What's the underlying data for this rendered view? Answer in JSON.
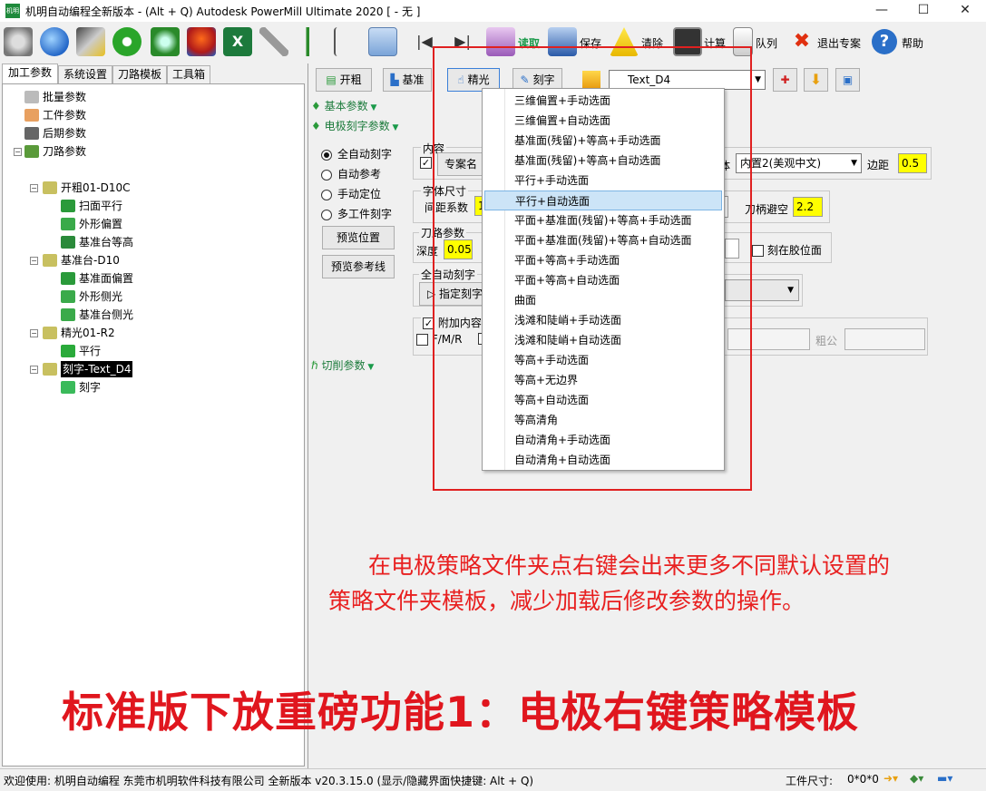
{
  "window": {
    "title": "机明自动编程全新版本 - (Alt + Q) Autodesk PowerMill Ultimate 2020   [ - 无 ]",
    "minimize": "—",
    "maximize": "☐",
    "close": "✕"
  },
  "toolbar": {
    "read": "读取",
    "save": "保存",
    "clear": "清除",
    "calculate": "计算",
    "queue": "队列",
    "exit_project": "退出专案",
    "help": "帮助"
  },
  "left_tabs": [
    "加工参数",
    "系统设置",
    "刀路模板",
    "工具箱"
  ],
  "tree": {
    "batch": "批量参数",
    "workpiece": "工件参数",
    "post": "后期参数",
    "toolpath": "刀路参数",
    "group1": "开粗01-D10C",
    "g1_items": [
      "扫面平行",
      "外形偏置",
      "基准台等高"
    ],
    "group2": "基准台-D10",
    "g2_items": [
      "基准面偏置",
      "外形侧光",
      "基准台侧光"
    ],
    "group3": "精光01-R2",
    "g3_items": [
      "平行"
    ],
    "group4": "刻字-Text_D4",
    "g4_items": [
      "刻字"
    ]
  },
  "strategy_tabs": {
    "rough": "开粗",
    "base": "基准",
    "finish": "精光",
    "engrave": "刻字",
    "text_combo": "Text_D4"
  },
  "sections": {
    "basic": "基本参数",
    "electrode_engrave": "电极刻字参数",
    "cutting": "切削参数"
  },
  "engrave_mode": {
    "options": [
      "全自动刻字",
      "自动参考",
      "手动定位",
      "多工件刻字"
    ],
    "selected": 0,
    "preview_pos": "预览位置",
    "preview_ref": "预览参考线"
  },
  "content_group": {
    "title": "内容",
    "project_name": "专案名",
    "font_label": "体",
    "font_value": "内置2(美观中文)",
    "margin_label": "边距",
    "margin_value": "0.5"
  },
  "size_group": {
    "title": "字体尺寸",
    "spacing_label": "间距系数",
    "spacing_value": "1",
    "holder_label": "刀柄避空",
    "holder_value": "2.2"
  },
  "path_group": {
    "title": "刀路参数",
    "depth_label": "深度",
    "depth_value": "0.05",
    "engrave_on_glue": "刻在胶位面"
  },
  "auto_group": {
    "title": "全自动刻字",
    "specify": "指定刻字"
  },
  "extra_group": {
    "extra_content": "附加内容",
    "fmr": "F/M/R",
    "gap_label": "粗公"
  },
  "dropdown": {
    "items": [
      "三维偏置+手动选面",
      "三维偏置+自动选面",
      "基准面(残留)+等高+手动选面",
      "基准面(残留)+等高+自动选面",
      "平行+手动选面",
      "平行+自动选面",
      "平面+基准面(残留)+等高+手动选面",
      "平面+基准面(残留)+等高+自动选面",
      "平面+等高+手动选面",
      "平面+等高+自动选面",
      "曲面",
      "浅滩和陡峭+手动选面",
      "浅滩和陡峭+自动选面",
      "等高+手动选面",
      "等高+无边界",
      "等高+自动选面",
      "等高清角",
      "自动清角+手动选面",
      "自动清角+自动选面"
    ],
    "selected": 5
  },
  "annotation": {
    "line1": "在电极策略文件夹点右键会出来更多不同默认设置的",
    "line2": "策略文件夹模板，减少加载后修改参数的操作。",
    "headline": "标准版下放重磅功能1：电极右键策略模板",
    "color": "#e02020"
  },
  "status": {
    "welcome": "欢迎使用: 机明自动编程 东莞市机明软件科技有限公司 全新版本 v20.3.15.0  (显示/隐藏界面快捷键: Alt + Q)",
    "work_size_label": "工件尺寸:",
    "work_size_value": "0*0*0"
  }
}
